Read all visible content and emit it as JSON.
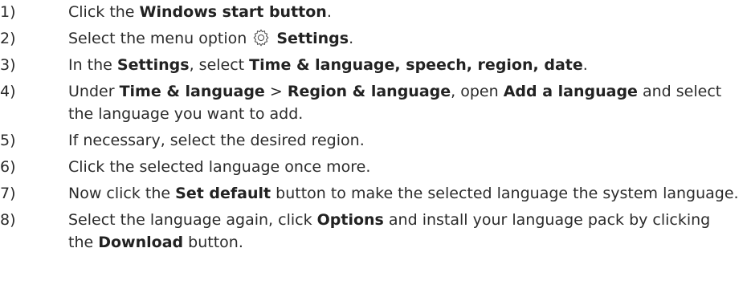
{
  "steps": [
    {
      "number": "1)",
      "t1": "Click the ",
      "b1": "Windows start button",
      "t2": "."
    },
    {
      "number": "2)",
      "t1": "Select the menu option ",
      "icon": "gear-icon",
      "b1": "Settings",
      "t2": "."
    },
    {
      "number": "3)",
      "t1": "In the ",
      "b1": "Settings",
      "t2": ", select ",
      "b2": "Time & language, speech, region, date",
      "t3": "."
    },
    {
      "number": "4)",
      "t1": "Under ",
      "b1": "Time & language",
      "t2": " > ",
      "b2": "Region & language",
      "t3": ", open ",
      "b3": "Add a language",
      "t4": " and select the language you want to add."
    },
    {
      "number": "5)",
      "t1": "If necessary, select the desired region."
    },
    {
      "number": "6)",
      "t1": "Click the selected language once more."
    },
    {
      "number": "7)",
      "t1": "Now click the ",
      "b1": "Set default",
      "t2": " button to make the selected language the system language."
    },
    {
      "number": "8)",
      "t1": "Select the language again, click ",
      "b1": "Options",
      "t2": " and install your language pack by clicking the ",
      "b2": "Download",
      "t3": " button."
    }
  ]
}
